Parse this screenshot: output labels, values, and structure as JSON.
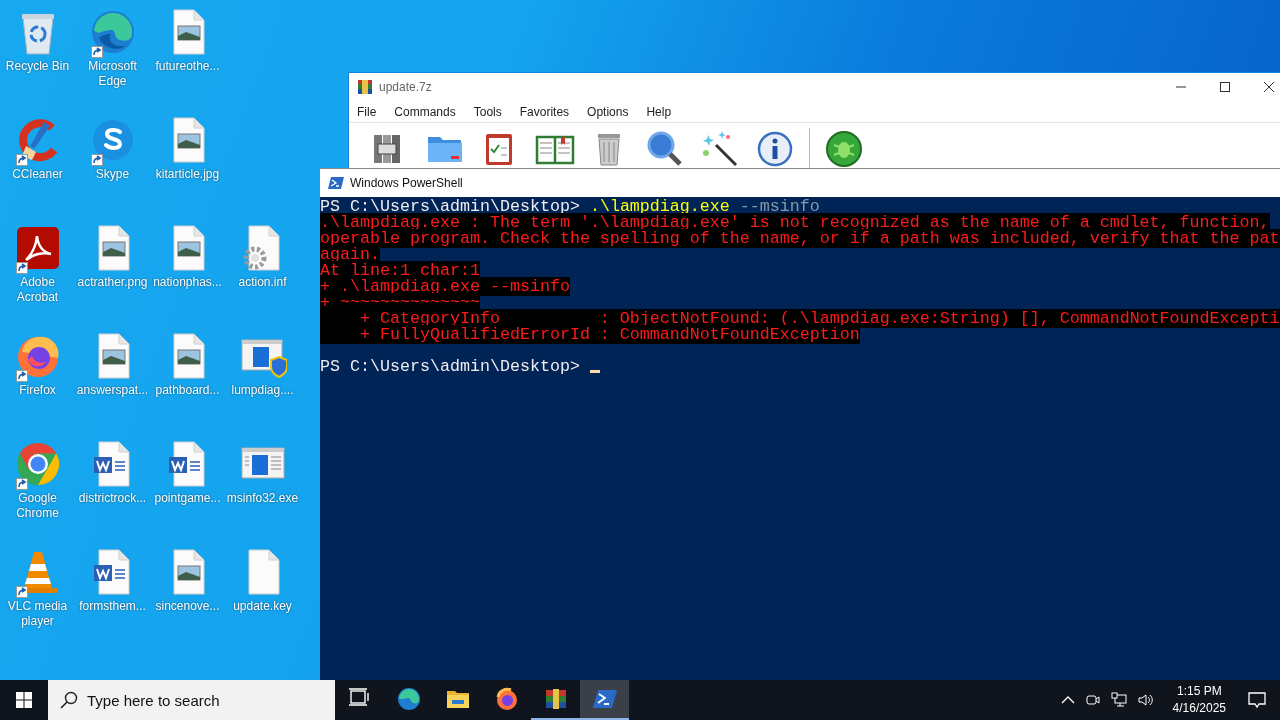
{
  "desktop": {
    "columns": [
      [
        {
          "label": "Recycle Bin",
          "kind": "recycle",
          "shortcut": false
        },
        {
          "label": "CCleaner",
          "kind": "ccleaner",
          "shortcut": true
        },
        {
          "label": "Adobe Acrobat",
          "kind": "acrobat",
          "shortcut": true
        },
        {
          "label": "Firefox",
          "kind": "firefox",
          "shortcut": true
        },
        {
          "label": "Google Chrome",
          "kind": "chrome",
          "shortcut": true
        },
        {
          "label": "VLC media player",
          "kind": "vlc",
          "shortcut": true
        }
      ],
      [
        {
          "label": "Microsoft Edge",
          "kind": "edge",
          "shortcut": true
        },
        {
          "label": "Skype",
          "kind": "skype",
          "shortcut": true
        },
        {
          "label": "actrather.png",
          "kind": "image",
          "shortcut": false
        },
        {
          "label": "answerspat...",
          "kind": "image",
          "shortcut": false
        },
        {
          "label": "districtrock...",
          "kind": "word",
          "shortcut": false
        },
        {
          "label": "formsthem...",
          "kind": "word",
          "shortcut": false
        }
      ],
      [
        {
          "label": "futureothe...",
          "kind": "image",
          "shortcut": false
        },
        {
          "label": "kitarticle.jpg",
          "kind": "image",
          "shortcut": false
        },
        {
          "label": "nationphas...",
          "kind": "image",
          "shortcut": false
        },
        {
          "label": "pathboard...",
          "kind": "image",
          "shortcut": false
        },
        {
          "label": "pointgame...",
          "kind": "word",
          "shortcut": false
        },
        {
          "label": "sincenove...",
          "kind": "image",
          "shortcut": false
        }
      ],
      [
        {
          "label": "action.inf",
          "kind": "settings-file",
          "shortcut": false
        },
        {
          "label": "lumpdiag....",
          "kind": "installer",
          "shortcut": false
        },
        {
          "label": "msinfo32.exe",
          "kind": "app-window",
          "shortcut": false
        },
        {
          "label": "update.key",
          "kind": "blank",
          "shortcut": false
        }
      ]
    ]
  },
  "archive_window": {
    "title": "update.7z",
    "menu": [
      "File",
      "Commands",
      "Tools",
      "Favorites",
      "Options",
      "Help"
    ]
  },
  "powershell": {
    "title": "Windows PowerShell",
    "lines": [
      [
        {
          "text": "PS C:\\Users\\admin\\Desktop> ",
          "kind": "prompt"
        },
        {
          "text": ".\\lampdiag.exe",
          "kind": "command"
        },
        {
          "text": " --msinfo",
          "kind": "parameter"
        }
      ],
      [
        {
          "text": ".\\lampdiag.exe : The term '.\\lampdiag.exe' is not recognized as the name of a cmdlet, function,",
          "kind": "error"
        }
      ],
      [
        {
          "text": "operable program. Check the spelling of the name, or if a path was included, verify that the pat",
          "kind": "error"
        }
      ],
      [
        {
          "text": "again.",
          "kind": "error"
        }
      ],
      [
        {
          "text": "At line:1 char:1",
          "kind": "error"
        }
      ],
      [
        {
          "text": "+ .\\lampdiag.exe --msinfo",
          "kind": "error"
        }
      ],
      [
        {
          "text": "+ ~~~~~~~~~~~~~~",
          "kind": "error"
        }
      ],
      [
        {
          "text": "    + CategoryInfo          : ObjectNotFound: (.\\lampdiag.exe:String) [], CommandNotFoundExcepti",
          "kind": "error"
        }
      ],
      [
        {
          "text": "    + FullyQualifiedErrorId : CommandNotFoundException",
          "kind": "error"
        }
      ]
    ],
    "prompt": {
      "text": "PS C:\\Users\\admin\\Desktop> ",
      "cursor": true
    }
  },
  "taskbar": {
    "search": {
      "placeholder": "Type here to search"
    },
    "apps": [
      {
        "kind": "task-view",
        "running": false,
        "selected": false
      },
      {
        "kind": "edge",
        "running": false,
        "selected": false
      },
      {
        "kind": "folder",
        "running": false,
        "selected": false
      },
      {
        "kind": "firefox",
        "running": false,
        "selected": false
      },
      {
        "kind": "archiver",
        "running": true,
        "selected": false
      },
      {
        "kind": "powershell",
        "running": true,
        "selected": true
      }
    ],
    "clock": {
      "time": "1:15 PM",
      "date": "4/16/2025"
    }
  }
}
